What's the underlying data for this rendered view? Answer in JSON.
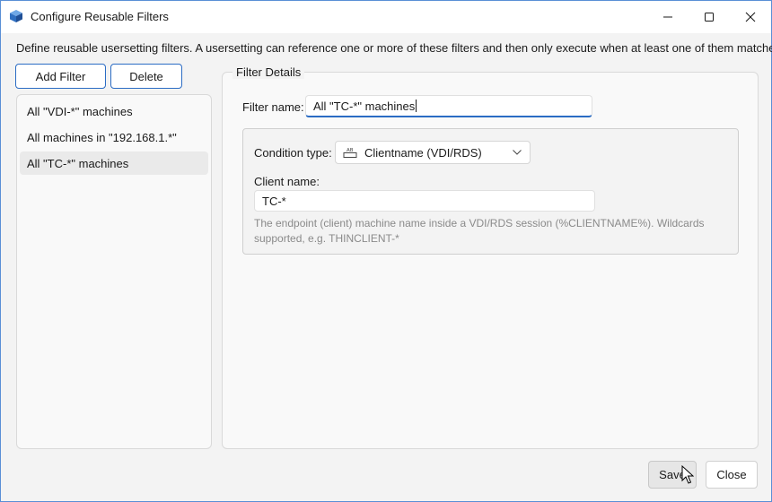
{
  "window": {
    "title": "Configure Reusable Filters",
    "icon": "cube-icon",
    "controls": [
      "minimize-icon",
      "maximize-icon",
      "close-icon"
    ]
  },
  "description": "Define reusable usersetting filters. A usersetting can reference one or more of these filters and then only execute when at least one of them matches.",
  "toolbar": {
    "add_label": "Add Filter",
    "delete_label": "Delete"
  },
  "filters": [
    {
      "label": "All \"VDI-*\" machines",
      "selected": false
    },
    {
      "label": "All machines in \"192.168.1.*\"",
      "selected": false
    },
    {
      "label": "All \"TC-*\" machines",
      "selected": true
    }
  ],
  "details": {
    "legend": "Filter Details",
    "name_label": "Filter name:",
    "name_value": "All \"TC-*\" machines",
    "condition_label": "Condition type:",
    "condition_value": "Clientname (VDI/RDS)",
    "condition_icon": "ab-textfield-icon",
    "client_label": "Client name:",
    "client_value": "TC-*",
    "hint": "The endpoint (client) machine name inside a VDI/RDS session (%CLIENTNAME%). Wildcards supported, e.g. THINCLIENT-*"
  },
  "footer": {
    "save_label": "Save",
    "close_label": "Close"
  },
  "colors": {
    "accent": "#2b6cc4",
    "window_bg": "#f3f3f3",
    "hint_text": "#8a8a8a"
  }
}
